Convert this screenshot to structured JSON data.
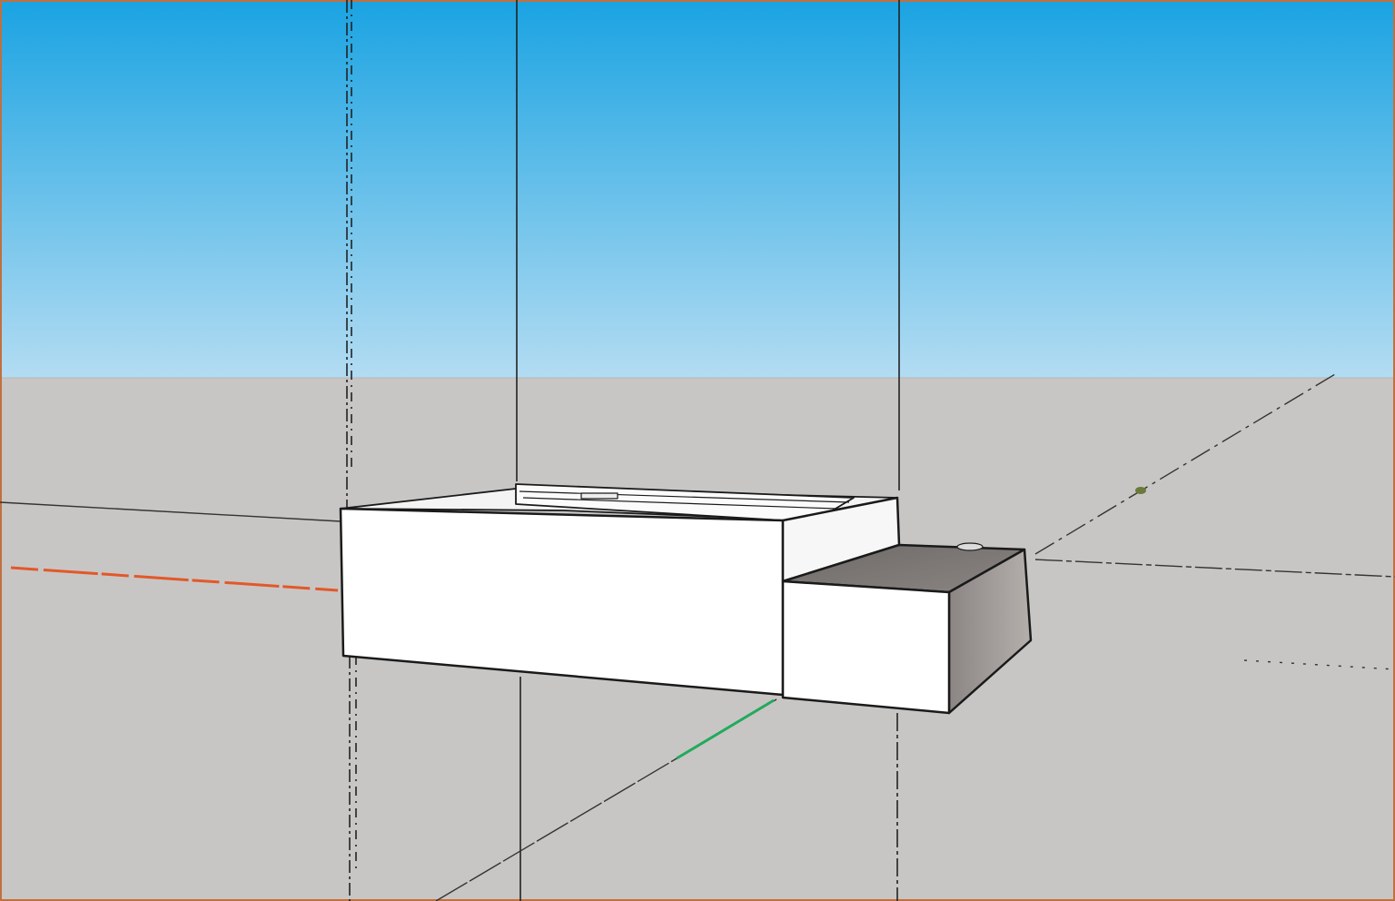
{
  "viewport": {
    "view": "3d-perspective",
    "sky_gradient": {
      "top": "#1aa3e2",
      "bottom": "#b3dcf2"
    },
    "ground_color": "#c8c6c4",
    "axes": {
      "red_axis_color": "#e2582a",
      "green_axis_color": "#22aa5c",
      "blue_axis_color": "#2a2a2a"
    },
    "model": {
      "description_icon": "box-model-icon",
      "face_color_light": "#ffffff",
      "face_color_shaded": "#7e7a78",
      "edge_color": "#1a1a1a"
    },
    "guide_line_color": "#222222",
    "inference_point_color": "#6a7a3a"
  }
}
